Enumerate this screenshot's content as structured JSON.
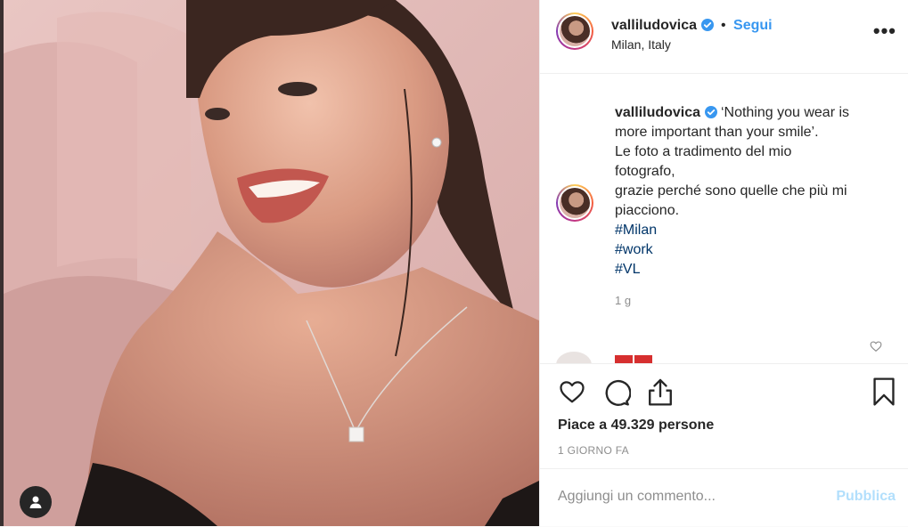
{
  "post": {
    "username": "valliludovica",
    "verified": true,
    "follow_label": "Segui",
    "separator": "•",
    "location": "Milan, Italy",
    "more_label": "•••"
  },
  "caption": {
    "username": "valliludovica",
    "lines": [
      "‘Nothing you wear is",
      "more important than your smile’.",
      "Le foto a tradimento del mio",
      "fotografo,",
      "grazie perché sono quelle che più mi",
      "piacciono."
    ],
    "hashtags": [
      "#Milan",
      "#work",
      "#VL"
    ],
    "time_ago": "1 g"
  },
  "actions": {
    "likes_text": "Piace a 49.329 persone",
    "date_text": "1 GIORNO FA"
  },
  "comment": {
    "placeholder": "Aggiungi un commento...",
    "publish_label": "Pubblica"
  },
  "colors": {
    "accent": "#3897f0",
    "hashtag": "#003569",
    "publish_disabled": "#b2dffc",
    "muted": "#8e8e8e"
  },
  "icons": {
    "like": "heart-icon",
    "comment": "comment-bubble-icon",
    "share": "share-icon",
    "save": "bookmark-icon",
    "user_tag": "user-icon",
    "verified": "verified-badge-icon"
  }
}
